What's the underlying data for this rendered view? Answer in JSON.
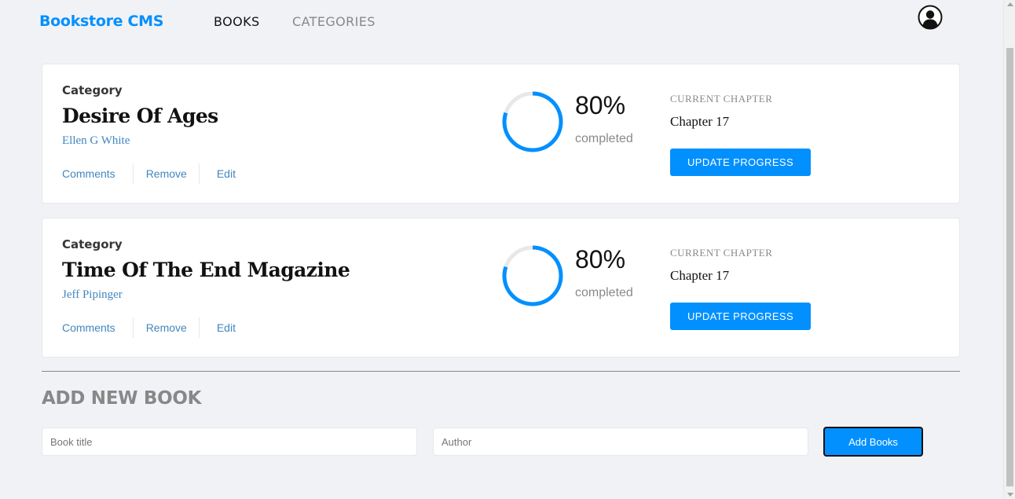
{
  "header": {
    "brand": "Bookstore CMS",
    "nav": [
      {
        "label": "BOOKS",
        "active": true
      },
      {
        "label": "CATEGORIES",
        "active": false
      }
    ],
    "user_icon": "user-avatar-icon"
  },
  "books": [
    {
      "category": "Category",
      "title": "Desire Of Ages",
      "author": "Ellen G White",
      "actions": [
        "Comments",
        "Remove",
        "Edit"
      ],
      "progress_percent": 80,
      "progress_label": "80%",
      "completed_label": "completed",
      "current_chapter_label": "CURRENT CHAPTER",
      "chapter": "Chapter 17",
      "update_label": "UPDATE PROGRESS"
    },
    {
      "category": "Category",
      "title": "Time Of The End Magazine",
      "author": "Jeff Pipinger",
      "actions": [
        "Comments",
        "Remove",
        "Edit"
      ],
      "progress_percent": 80,
      "progress_label": "80%",
      "completed_label": "completed",
      "current_chapter_label": "CURRENT CHAPTER",
      "chapter": "Chapter 17",
      "update_label": "UPDATE PROGRESS"
    }
  ],
  "add_book": {
    "heading": "ADD NEW BOOK",
    "title_placeholder": "Book title",
    "author_placeholder": "Author",
    "submit_label": "Add Books"
  },
  "colors": {
    "accent": "#0290ff",
    "link": "#4386bf",
    "progress_track": "#e8e8e8",
    "background": "#f1f2f6"
  }
}
